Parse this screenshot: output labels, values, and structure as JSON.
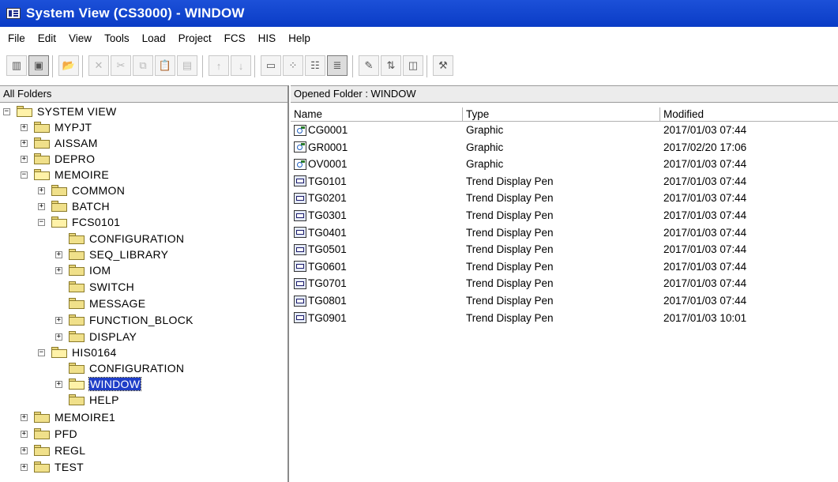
{
  "window": {
    "title": "System View (CS3000) - WINDOW"
  },
  "menu": [
    "File",
    "Edit",
    "View",
    "Tools",
    "Load",
    "Project",
    "FCS",
    "HIS",
    "Help"
  ],
  "left_pane": {
    "header": "All Folders",
    "tree": [
      {
        "label": "SYSTEM VIEW",
        "expander": "−"
      },
      {
        "label": "MYPJT",
        "expander": "+"
      },
      {
        "label": "AISSAM",
        "expander": "+"
      },
      {
        "label": "DEPRO",
        "expander": "+"
      },
      {
        "label": "MEMOIRE",
        "expander": "−"
      },
      {
        "label": "COMMON",
        "expander": "+"
      },
      {
        "label": "BATCH",
        "expander": "+"
      },
      {
        "label": "FCS0101",
        "expander": "−"
      },
      {
        "label": "CONFIGURATION",
        "expander": ""
      },
      {
        "label": "SEQ_LIBRARY",
        "expander": "+"
      },
      {
        "label": "IOM",
        "expander": "+"
      },
      {
        "label": "SWITCH",
        "expander": ""
      },
      {
        "label": "MESSAGE",
        "expander": ""
      },
      {
        "label": "FUNCTION_BLOCK",
        "expander": "+"
      },
      {
        "label": "DISPLAY",
        "expander": "+"
      },
      {
        "label": "HIS0164",
        "expander": "−"
      },
      {
        "label": "CONFIGURATION",
        "expander": ""
      },
      {
        "label": "WINDOW",
        "expander": "+"
      },
      {
        "label": "HELP",
        "expander": ""
      },
      {
        "label": "MEMOIRE1",
        "expander": "+"
      },
      {
        "label": "PFD",
        "expander": "+"
      },
      {
        "label": "REGL",
        "expander": "+"
      },
      {
        "label": "TEST",
        "expander": "+"
      }
    ]
  },
  "right_pane": {
    "header": "Opened Folder : WINDOW",
    "columns": [
      "Name",
      "Type",
      "Modified"
    ],
    "rows": [
      {
        "name": "CG0001",
        "type": "Graphic",
        "modified": "2017/01/03 07:44",
        "icon": "graphic-icon"
      },
      {
        "name": "GR0001",
        "type": "Graphic",
        "modified": "2017/02/20 17:06",
        "icon": "graphic-icon"
      },
      {
        "name": "OV0001",
        "type": "Graphic",
        "modified": "2017/01/03 07:44",
        "icon": "graphic-icon"
      },
      {
        "name": "TG0101",
        "type": "Trend Display Pen",
        "modified": "2017/01/03 07:44",
        "icon": "trend-icon"
      },
      {
        "name": "TG0201",
        "type": "Trend Display Pen",
        "modified": "2017/01/03 07:44",
        "icon": "trend-icon"
      },
      {
        "name": "TG0301",
        "type": "Trend Display Pen",
        "modified": "2017/01/03 07:44",
        "icon": "trend-icon"
      },
      {
        "name": "TG0401",
        "type": "Trend Display Pen",
        "modified": "2017/01/03 07:44",
        "icon": "trend-icon"
      },
      {
        "name": "TG0501",
        "type": "Trend Display Pen",
        "modified": "2017/01/03 07:44",
        "icon": "trend-icon"
      },
      {
        "name": "TG0601",
        "type": "Trend Display Pen",
        "modified": "2017/01/03 07:44",
        "icon": "trend-icon"
      },
      {
        "name": "TG0701",
        "type": "Trend Display Pen",
        "modified": "2017/01/03 07:44",
        "icon": "trend-icon"
      },
      {
        "name": "TG0801",
        "type": "Trend Display Pen",
        "modified": "2017/01/03 07:44",
        "icon": "trend-icon"
      },
      {
        "name": "TG0901",
        "type": "Trend Display Pen",
        "modified": "2017/01/03 10:01",
        "icon": "trend-icon"
      }
    ]
  },
  "toolbar_icons": [
    "system-view-icon",
    "display-icon",
    "open-folder-icon",
    "delete-icon",
    "cut-icon",
    "copy-icon",
    "paste-icon",
    "paste-special-icon",
    "up-arrow-icon",
    "down-arrow-icon",
    "large-icons-icon",
    "small-icons-icon",
    "list-icon",
    "details-icon",
    "properties-icon",
    "sort-icon",
    "viewer-icon",
    "tools-icon"
  ]
}
